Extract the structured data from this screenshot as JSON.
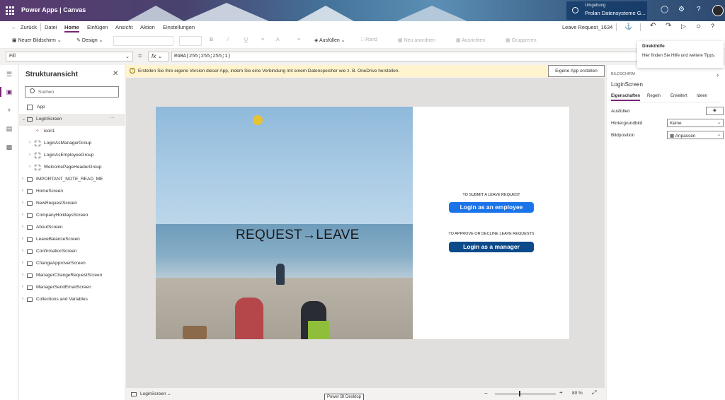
{
  "header": {
    "app_title": "Power Apps  |  Canvas",
    "env_label": "Umgebung",
    "env_name": "Prolan Datensysteme G..."
  },
  "menu": {
    "back": "Zurück",
    "items": [
      "Datei",
      "Home",
      "Einfügen",
      "Ansicht",
      "Aktion",
      "Einstellungen"
    ],
    "active": "Home",
    "app_name": "Leave Request_1634"
  },
  "toolbar": {
    "new_screen": "Neuer Bildschirm",
    "design": "Design",
    "fill": "Ausfüllen",
    "border": "Rand",
    "reorder": "Neu anordnen",
    "align": "Ausrichten",
    "group": "Gruppieren"
  },
  "formula": {
    "property": "Fill",
    "fx": "fx",
    "value": "RGBA(255;255;255;1)"
  },
  "tree": {
    "title": "Strukturansicht",
    "search_placeholder": "Suchen",
    "items": [
      {
        "label": "App"
      },
      {
        "label": "LoginScreen",
        "more": "···"
      },
      {
        "label": "icon1"
      },
      {
        "label": "LoginAsManagerGroup"
      },
      {
        "label": "LoginAsEmployeeGroup"
      },
      {
        "label": "WelcomePageHeaderGroup"
      },
      {
        "label": "IMPORTANT_NOTE_READ_ME"
      },
      {
        "label": "HomeScreen"
      },
      {
        "label": "NewRequestScreen"
      },
      {
        "label": "CompanyHolidaysScreen"
      },
      {
        "label": "AboutScreen"
      },
      {
        "label": "LeaveBalanceScreen"
      },
      {
        "label": "ConfirmationScreen"
      },
      {
        "label": "ChangeApproverScreen"
      },
      {
        "label": "ManagerChangeRequestScreen"
      },
      {
        "label": "ManagerSendEmailScreen"
      },
      {
        "label": "Collections and Variables"
      }
    ]
  },
  "banner": {
    "text": "Erstellen Sie Ihre eigene Version dieser App, indem Sie eine Verbindung mit einem Datenspeicher wie z. B. OneDrive herstellen.",
    "button": "Eigene App erstellen"
  },
  "screen": {
    "headline": "REQUEST→LEAVE",
    "employee_caption": "TO SUBMIT A LEAVE REQUEST",
    "employee_button": "Login as an employee",
    "manager_caption": "TO APPROVE OR DECLINE LEAVE REQUESTS",
    "manager_button": "Login as a manager"
  },
  "status": {
    "screen_name": "LoginScreen",
    "zoom": "80 %",
    "tooltip": "Power BI Desktop"
  },
  "properties": {
    "section": "BILDSCHIRM",
    "name": "LoginScreen",
    "tabs": [
      "Eigenschaften",
      "Regeln",
      "Erweitert",
      "Ideen"
    ],
    "fill_label": "Ausfüllen",
    "bg_label": "Hintergrundbild",
    "bg_value": "Keine",
    "pos_label": "Bildposition",
    "pos_value": "Anpassen"
  },
  "help": {
    "title": "Direkthilfe",
    "text": "Hier finden Sie Hilfe und weitere Tipps."
  },
  "colors": {
    "accent": "#742774",
    "employee_button": "#1a73e8",
    "manager_button": "#0d4a8a",
    "banner": "#fff4ce"
  }
}
